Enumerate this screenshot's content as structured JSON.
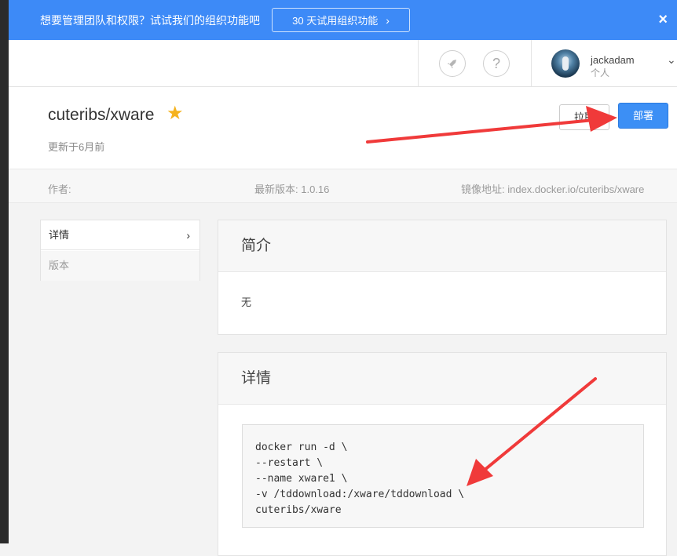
{
  "banner": {
    "text": "想要管理团队和权限？试试我们的组织功能吧",
    "trial_button": "30 天试用组织功能",
    "trial_chevron": "›",
    "close_glyph": "×"
  },
  "topbar": {
    "rocket_icon": "rocket-icon",
    "help_icon": "question-icon",
    "help_glyph": "?",
    "user": {
      "name": "jackadam",
      "account_type": "个人",
      "chevron": "⌄"
    }
  },
  "repo": {
    "title": "cuteribs/xware",
    "star_glyph": "★",
    "updated": "更新于6月前",
    "pull_button": "拉取",
    "deploy_button": "部署"
  },
  "meta": {
    "author": "作者:",
    "latest_version": "最新版本: 1.0.16",
    "image_address": "镜像地址: index.docker.io/cuteribs/xware"
  },
  "side_nav": {
    "items": [
      {
        "label": "详情",
        "chevron": "›"
      },
      {
        "label": "版本"
      }
    ]
  },
  "intro": {
    "heading": "简介",
    "body": "无"
  },
  "details": {
    "heading": "详情",
    "code": "docker run -d \\\n--restart \\\n--name xware1 \\\n-v /tddownload:/xware/tddownload \\\ncuteribs/xware"
  },
  "colors": {
    "banner": "#3d8af7",
    "primary_button": "#3c8ff5",
    "star": "#f5b21d",
    "annotation_arrow": "#f03a3a"
  }
}
